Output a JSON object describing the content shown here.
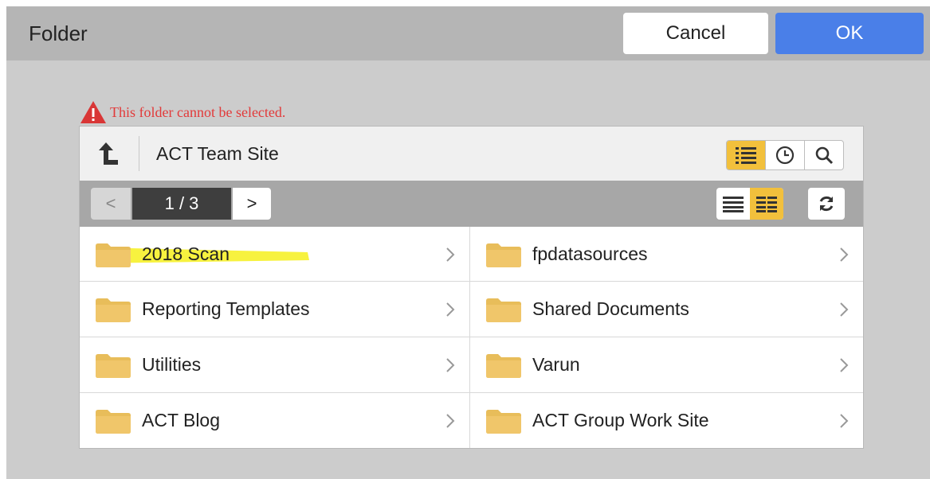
{
  "dialog": {
    "title": "Folder",
    "cancel_label": "Cancel",
    "ok_label": "OK",
    "ok_color": "#4a7fe8"
  },
  "warning": {
    "message": "This folder cannot be selected.",
    "icon": "warning-triangle-icon",
    "color": "#e23a3a"
  },
  "browser": {
    "location": "ACT Team Site",
    "up_icon": "up-arrow-icon",
    "views": [
      {
        "icon": "list-icon",
        "active": true
      },
      {
        "icon": "clock-icon",
        "active": false
      },
      {
        "icon": "search-icon",
        "active": false
      }
    ],
    "pager": {
      "prev_label": "<",
      "page_indicator": "1 / 3",
      "next_label": ">"
    },
    "layouts": [
      {
        "icon": "single-column-icon",
        "active": false
      },
      {
        "icon": "two-column-icon",
        "active": true
      }
    ],
    "refresh_icon": "refresh-icon",
    "accent_color": "#f2c03c",
    "folders": [
      {
        "name": "2018 Scan",
        "highlighted": true
      },
      {
        "name": "fpdatasources"
      },
      {
        "name": "Reporting Templates"
      },
      {
        "name": "Shared Documents"
      },
      {
        "name": "Utilities"
      },
      {
        "name": "Varun"
      },
      {
        "name": "ACT Blog"
      },
      {
        "name": "ACT Group Work Site"
      }
    ]
  }
}
